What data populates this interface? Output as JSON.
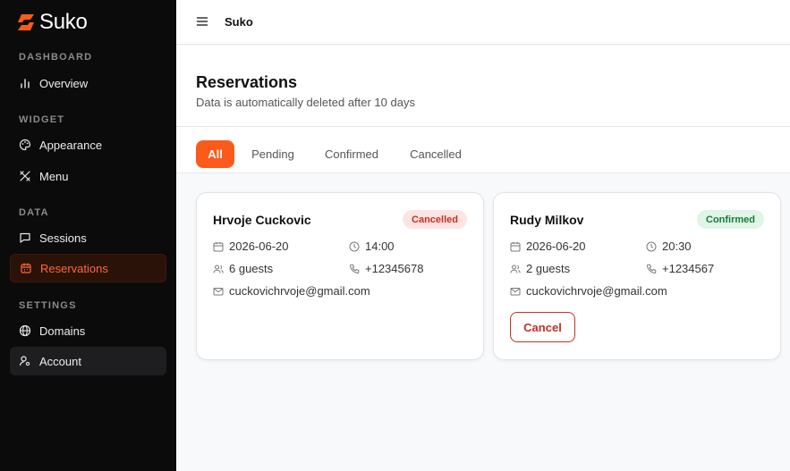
{
  "app": {
    "name": "Suko"
  },
  "sidebar": {
    "sections": [
      {
        "title": "DASHBOARD"
      },
      {
        "title": "WIDGET"
      },
      {
        "title": "DATA"
      },
      {
        "title": "SETTINGS"
      }
    ],
    "items": [
      {
        "label": "Overview",
        "icon": "bar-chart-icon"
      },
      {
        "label": "Appearance",
        "icon": "palette-icon"
      },
      {
        "label": "Menu",
        "icon": "utensils-icon"
      },
      {
        "label": "Sessions",
        "icon": "message-icon"
      },
      {
        "label": "Reservations",
        "icon": "calendar-icon",
        "active": true
      },
      {
        "label": "Domains",
        "icon": "globe-icon"
      },
      {
        "label": "Account",
        "icon": "user-cog-icon",
        "hover": true
      }
    ]
  },
  "topbar": {
    "breadcrumb": "Suko"
  },
  "page": {
    "title": "Reservations",
    "subtitle": "Data is automatically deleted after 10 days"
  },
  "tabs": [
    {
      "label": "All",
      "active": true
    },
    {
      "label": "Pending"
    },
    {
      "label": "Confirmed"
    },
    {
      "label": "Cancelled"
    }
  ],
  "reservations": [
    {
      "name": "Hrvoje Cuckovic",
      "status": "Cancelled",
      "date": "2026-06-20",
      "time": "14:00",
      "guests": "6 guests",
      "phone": "+12345678",
      "email": "cuckovichrvoje@gmail.com"
    },
    {
      "name": "Rudy Milkov",
      "status": "Confirmed",
      "date": "2026-06-20",
      "time": "20:30",
      "guests": "2 guests",
      "phone": "+1234567",
      "email": "cuckovichrvoje@gmail.com",
      "action": "Cancel"
    }
  ],
  "colors": {
    "accent": "#fa5b1c",
    "sidebar_bg": "#0b0b0c",
    "danger": "#c62f24",
    "success": "#1b7a3a"
  }
}
